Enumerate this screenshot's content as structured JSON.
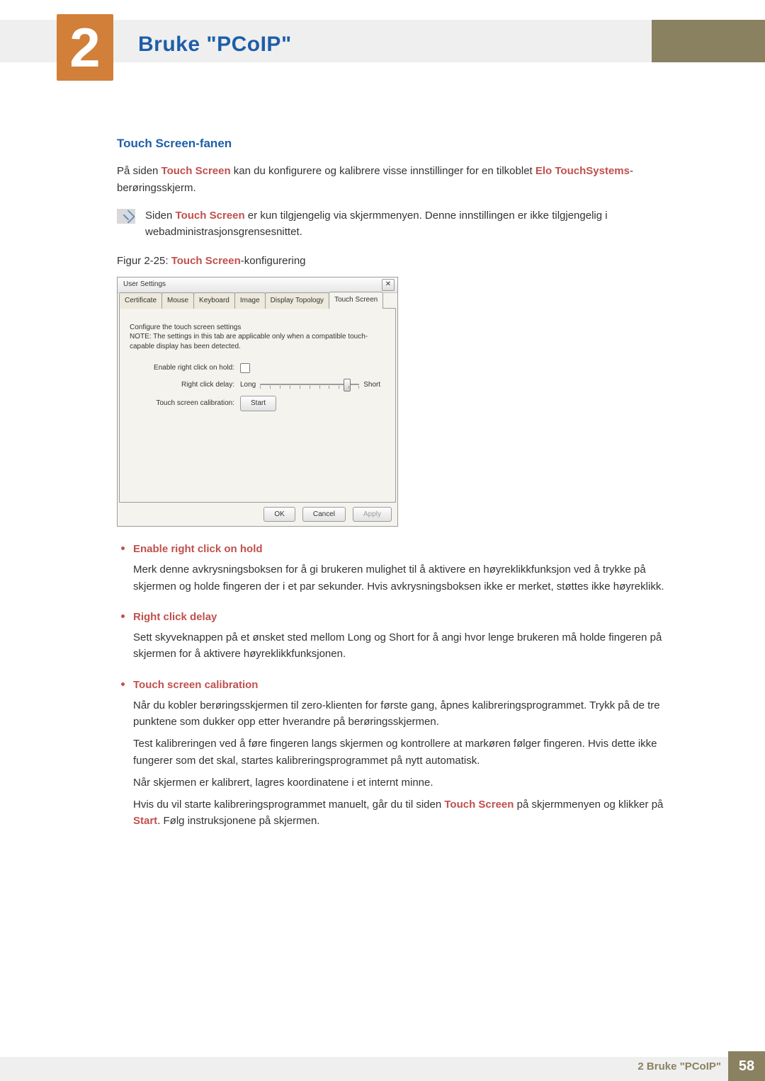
{
  "header": {
    "chapter_number": "2",
    "chapter_title": "Bruke \"PCoIP\""
  },
  "section": {
    "heading": "Touch Screen-fanen"
  },
  "intro": {
    "pre": "På siden ",
    "hl1": "Touch Screen",
    "mid": " kan du konfigurere og kalibrere visse innstillinger for en tilkoblet ",
    "hl2": "Elo TouchSystems",
    "post": "-berøringsskjerm."
  },
  "note": {
    "pre": "Siden ",
    "hl": "Touch Screen",
    "post": " er kun tilgjengelig via skjermmenyen. Denne innstillingen er ikke tilgjengelig i webadministrasjonsgrensesnittet."
  },
  "figure": {
    "pre": "Figur 2-25: ",
    "hl": "Touch Screen",
    "post": "-konfigurering"
  },
  "dialog": {
    "title": "User Settings",
    "close": "✕",
    "tabs": [
      "Certificate",
      "Mouse",
      "Keyboard",
      "Image",
      "Display Topology",
      "Touch Screen"
    ],
    "active_tab": 5,
    "desc_line1": "Configure the touch screen settings",
    "desc_line2": "NOTE: The settings in this tab are applicable only when a compatible touch-capable display has been detected.",
    "fields": {
      "enable_label": "Enable right click on hold:",
      "delay_label": "Right click delay:",
      "delay_min": "Long",
      "delay_max": "Short",
      "calib_label": "Touch screen calibration:",
      "calib_button": "Start"
    },
    "buttons": {
      "ok": "OK",
      "cancel": "Cancel",
      "apply": "Apply"
    }
  },
  "bullets": [
    {
      "heading": "Enable right click on hold",
      "paras": [
        "Merk denne avkrysningsboksen for å gi brukeren mulighet til å aktivere en høyreklikkfunksjon ved å trykke på skjermen og holde fingeren der i et par sekunder. Hvis avkrysningsboksen ikke er merket, støttes ikke høyreklikk."
      ]
    },
    {
      "heading": "Right click delay",
      "paras": [
        "Sett skyveknappen på et ønsket sted mellom Long og Short for å angi hvor lenge brukeren må holde fingeren på skjermen for å aktivere høyreklikkfunksjonen."
      ]
    },
    {
      "heading": "Touch screen calibration",
      "paras": [
        "Når du kobler berøringsskjermen til zero-klienten for første gang, åpnes kalibreringsprogrammet. Trykk på de tre punktene som dukker opp etter hverandre på berøringsskjermen.",
        "Test kalibreringen ved å føre fingeren langs skjermen og kontrollere at markøren følger fingeren. Hvis dette ikke fungerer som det skal, startes kalibreringsprogrammet på nytt automatisk.",
        "Når skjermen er kalibrert, lagres koordinatene i et internt minne."
      ],
      "last": {
        "pre": "Hvis du vil starte kalibreringsprogrammet manuelt, går du til siden ",
        "hl1": "Touch Screen",
        "mid": " på skjermmenyen og klikker på ",
        "hl2": "Start",
        "post": ". Følg instruksjonene på skjermen."
      }
    }
  ],
  "footer": {
    "label": "2 Bruke \"PCoIP\"",
    "page": "58"
  }
}
